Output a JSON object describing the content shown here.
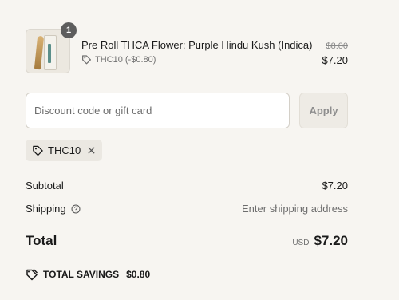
{
  "line_item": {
    "quantity": "1",
    "title": "Pre Roll THCA Flower: Purple Hindu Kush (Indica)",
    "discount_note": "THC10 (-$0.80)",
    "original_price": "$8.00",
    "price": "$7.20",
    "image_icon": "pre-roll-product-image"
  },
  "discount": {
    "placeholder": "Discount code or gift card",
    "value": "",
    "apply_label": "Apply",
    "applied_code": "THC10"
  },
  "summary": {
    "subtotal_label": "Subtotal",
    "subtotal_value": "$7.20",
    "shipping_label": "Shipping",
    "shipping_value": "Enter shipping address",
    "total_label": "Total",
    "currency": "USD",
    "total_value": "$7.20",
    "savings_label": "TOTAL SAVINGS",
    "savings_value": "$0.80"
  },
  "colors": {
    "background": "#f7f5f1",
    "badge": "#5d5d5d",
    "muted_text": "#707070",
    "tag_background": "#ebe8e2"
  }
}
